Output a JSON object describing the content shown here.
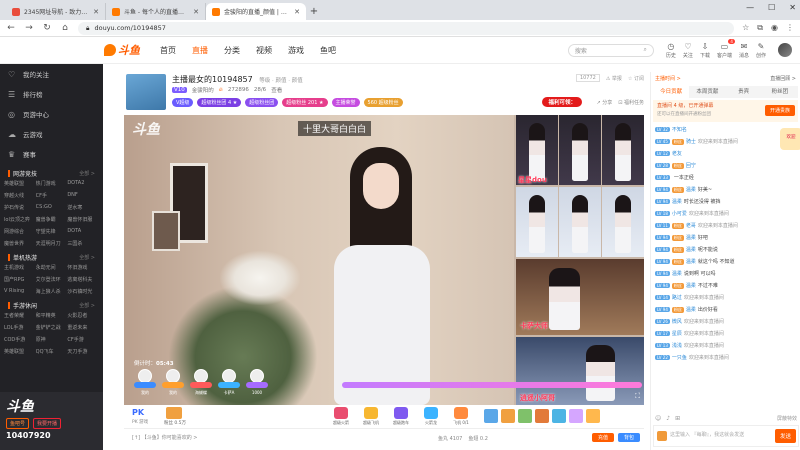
{
  "browser": {
    "tabs": [
      {
        "title": "2345网址导航 - 致力于打造百年品",
        "color": "#e94d3c",
        "active": false
      },
      {
        "title": "斗鱼 - 每个人的直播平台",
        "color": "#ff7a00",
        "active": false
      },
      {
        "title": "金骏阳的直播_颜值 | 斗鱼",
        "color": "#ff7a00",
        "active": true
      }
    ],
    "new_tab": "+",
    "url": "douyu.com/10194857",
    "window_controls": [
      "—",
      "☐",
      "✕"
    ]
  },
  "header": {
    "logo": "斗鱼",
    "nav": [
      "首页",
      "直播",
      "分类",
      "视频",
      "游戏",
      "鱼吧"
    ],
    "nav_active": "直播",
    "search_placeholder": "搜索",
    "icons": [
      {
        "label": "历史",
        "glyph": "◷"
      },
      {
        "label": "关注",
        "glyph": "♡"
      },
      {
        "label": "下载",
        "glyph": "⇩"
      },
      {
        "label": "客户端",
        "glyph": "▭",
        "badge": "4"
      },
      {
        "label": "消息",
        "glyph": "✉"
      },
      {
        "label": "创作",
        "glyph": "✎"
      }
    ]
  },
  "sidebar": {
    "items": [
      {
        "label": "我的关注",
        "glyph": "♡"
      },
      {
        "label": "排行榜",
        "glyph": "☰"
      },
      {
        "label": "页游中心",
        "glyph": "◎"
      },
      {
        "label": "云游戏",
        "glyph": "☁"
      },
      {
        "label": "赛事",
        "glyph": "♛"
      }
    ],
    "sections": [
      {
        "title": "网游竞技",
        "more": "全部 >",
        "items": [
          "英雄联盟",
          "热门游戏",
          "DOTA2",
          "穿越火线",
          "CF手",
          "DNF",
          "护石传说",
          "CS:GO",
          "逆水寒",
          "lol云顶之弈",
          "魔兽争霸",
          "魔兽怀旧服",
          "网游综合",
          "守望先锋",
          "DOTA",
          "魔兽世界",
          "天涯明月刀",
          "三国杀"
        ]
      },
      {
        "title": "单机热游",
        "more": "全部 >",
        "items": [
          "主机游戏",
          "永劫无间",
          "怀旧游戏",
          "国产RPG",
          "艾尔登法环",
          "逃离塔科夫",
          "V Rising",
          "海上狼人杀",
          "沙石镇时光"
        ]
      },
      {
        "title": "手游休闲",
        "more": "全部 >",
        "items": [
          "王者荣耀",
          "和平精英",
          "火影忍者",
          "LOL手游",
          "金铲铲之战",
          "重返未来",
          "COD手游",
          "原神",
          "CF手游",
          "英雄联盟",
          "QQ飞车",
          "天刀手游"
        ]
      }
    ],
    "bottom": {
      "logo": "斗鱼",
      "chip1": "鱼吧号",
      "chip2": "我要开播",
      "number": "10407920"
    }
  },
  "stream": {
    "title": "主播最女的10194857",
    "category": "等级 · 颜值 · 颜值",
    "meta": [
      "V10",
      "金骏阳的",
      "272896",
      "28/6",
      "查看"
    ],
    "pills": [
      {
        "label": "V超级",
        "color": "#6a5cff"
      },
      {
        "label": "超级粉丝团 4 ★",
        "color": "#7b3fe4"
      },
      {
        "label": "超级粉丝团",
        "color": "#8a4ff0"
      },
      {
        "label": "超级粉丝 201 ★",
        "color": "#e63e8c"
      },
      {
        "label": "主播荣誉",
        "color": "#c54ce0"
      },
      {
        "label": "560 超级粉丝",
        "color": "#e8a030"
      }
    ],
    "right_top": [
      "10772",
      "⚠ 举报",
      "☆ 订阅"
    ],
    "promo": "福利可领：",
    "right_bottom": [
      "↗ 分享",
      "⊡ 福利任务"
    ]
  },
  "video": {
    "logo": "斗鱼",
    "caption": "十里大哥白白白",
    "timer_label": "倒计时：",
    "timer": "05:43",
    "avatars": [
      {
        "name": "我的",
        "bar": "#3b8cff"
      },
      {
        "name": "我的",
        "bar": "#ff9f2d"
      },
      {
        "name": "海蝴蝶",
        "bar": "#ff5a5a"
      },
      {
        "name": "卡萨A",
        "bar": "#3bb3ff"
      },
      {
        "name": "1000",
        "bar": "#a66bff"
      }
    ],
    "side_labels": [
      "星星dou",
      "卡萨大师",
      "逍遥小阿哥"
    ],
    "fullscreen": "⛶"
  },
  "giftbar": {
    "pk": "PK",
    "pk_sub": "PK 游戏",
    "fans": "粉丝 0.5万",
    "gifts": [
      {
        "name": "超级火箭",
        "color": "#e94d6f"
      },
      {
        "name": "超级飞机",
        "color": "#f7b731"
      },
      {
        "name": "超级跑车",
        "color": "#7f5af0"
      },
      {
        "name": "火箭龙",
        "color": "#3bb3ff"
      },
      {
        "name": "飞机 0/1",
        "color": "#ff8a3d"
      }
    ],
    "extra_colors": [
      "#5aa7e8",
      "#f0a040",
      "#7fc16a",
      "#e27a3a",
      "#4cb4e4",
      "#d5a6ff",
      "#ffb84d"
    ]
  },
  "actbar": {
    "left": "[↑]",
    "notice": "【斗鱼】你可能喜欢的 >",
    "mid": [
      "鱼丸 4107",
      "鱼翅 0.2"
    ],
    "btn1": {
      "label": "充值",
      "color": "#ff5d00"
    },
    "btn2": {
      "label": "背包",
      "color": "#3a8cff"
    }
  },
  "chat": {
    "top": [
      "主播时间 >",
      "直播回顾 >"
    ],
    "tabs": [
      "今日贡献",
      "本周贡献",
      "贵宾",
      "粉丝团"
    ],
    "active_tab": "今日贡献",
    "notice_title": "直播间 4 级，已开通弹幕",
    "notice_sub": "还可以在直播间开通粉丝团",
    "notice_btn": "开通贵族",
    "messages": [
      {
        "level": "LV 32",
        "fan": "",
        "nick": "不知名",
        "text": ""
      },
      {
        "level": "LV 45",
        "fan": "粉丝",
        "nick": "骑士",
        "text": "欢迎来到本直播间"
      },
      {
        "level": "LV 12",
        "fan": "",
        "nick": "老友",
        "text": ""
      },
      {
        "level": "LV 28",
        "fan": "粉丝",
        "nick": "回宁",
        "text": ""
      },
      {
        "level": "LV 33",
        "fan": "",
        "nick": "",
        "text": "一本正经"
      },
      {
        "level": "LV 94",
        "fan": "粉丝",
        "nick": "温柔",
        "text": "好美~"
      },
      {
        "level": "LV 94",
        "fan": "",
        "nick": "温柔",
        "text": "时长还没得 被挡"
      },
      {
        "level": "LV 18",
        "fan": "",
        "nick": "小可爱",
        "text": "欢迎来到本直播间"
      },
      {
        "level": "LV 11",
        "fan": "粉丝",
        "nick": "老哥",
        "text": "欢迎来到本直播间"
      },
      {
        "level": "LV 94",
        "fan": "粉丝",
        "nick": "温柔",
        "text": "好吧"
      },
      {
        "level": "LV 94",
        "fan": "粉丝",
        "nick": "温柔",
        "text": "呢不能说"
      },
      {
        "level": "LV 94",
        "fan": "粉丝",
        "nick": "温柔",
        "text": "就这个吗 不知道"
      },
      {
        "level": "LV 94",
        "fan": "",
        "nick": "温柔",
        "text": "说到啊 可以吗"
      },
      {
        "level": "LV 94",
        "fan": "粉丝",
        "nick": "温柔",
        "text": "不过不难"
      },
      {
        "level": "LV 14",
        "fan": "",
        "nick": "路过",
        "text": "欢迎来到本直播间"
      },
      {
        "level": "LV 94",
        "fan": "粉丝",
        "nick": "温柔",
        "text": "出价好看"
      },
      {
        "level": "LV 26",
        "fan": "",
        "nick": "微风",
        "text": "欢迎来到本直播间"
      },
      {
        "level": "LV 17",
        "fan": "",
        "nick": "星辰",
        "text": "欢迎来到本直播间"
      },
      {
        "level": "LV 13",
        "fan": "",
        "nick": "浅浅",
        "text": "欢迎来到本直播间"
      },
      {
        "level": "LV 22",
        "fan": "",
        "nick": "一只鱼",
        "text": "欢迎来到本直播间"
      }
    ],
    "tools": [
      "☺",
      "♪",
      "⊞"
    ],
    "tools_right": "屏蔽特效",
    "input_placeholder": "这里输入 『每聊』，我这就会发送",
    "send": "发送",
    "float_ad": "欢迎"
  }
}
